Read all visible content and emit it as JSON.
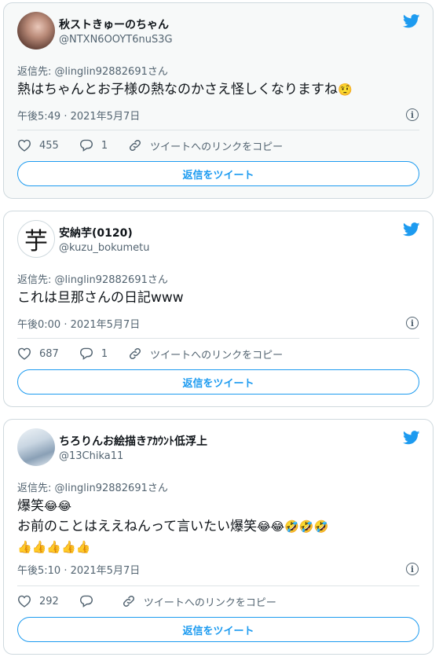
{
  "colors": {
    "accent": "#1d9bf0",
    "secondary_text": "#536471",
    "border": "#cfd9de"
  },
  "icons": [
    "twitter-bird-icon",
    "heart-icon",
    "reply-bubble-icon",
    "link-icon",
    "info-icon"
  ],
  "tweets": [
    {
      "name": "秋ストきゅーのちゃん",
      "handle": "@NTXN6OOYT6nuS3G",
      "reply_to": "返信先: @linglin92882691さん",
      "text_lines": [
        "熱はちゃんとお子様の熱なのかさえ怪しくなりますね"
      ],
      "emoji_line1": "🤨",
      "time": "午後5:49 · 2021年5月7日",
      "likes": "455",
      "replies": "1",
      "copy_link": "ツイートへのリンクをコピー",
      "reply_button": "返信をツイート"
    },
    {
      "name": "安納芋(0120)",
      "handle": "@kuzu_bokumetu",
      "avatar_char": "芋",
      "reply_to": "返信先: @linglin92882691さん",
      "text_lines": [
        "これは旦那さんの日記www"
      ],
      "time": "午後0:00 · 2021年5月7日",
      "likes": "687",
      "replies": "1",
      "copy_link": "ツイートへのリンクをコピー",
      "reply_button": "返信をツイート"
    },
    {
      "name": "ちろりんお絵描きｱｶｳﾝﾄ低浮上",
      "handle": "@13Chika11",
      "reply_to": "返信先: @linglin92882691さん",
      "text_lines": [
        "爆笑",
        "お前のことはええねんって言いたい爆笑"
      ],
      "emoji_line1": "😂😂",
      "emoji_line2": "😂😂🤣🤣🤣",
      "emoji_line3": "👍👍👍👍👍",
      "time": "午後5:10 · 2021年5月7日",
      "likes": "292",
      "copy_link": "ツイートへのリンクをコピー",
      "reply_button": "返信をツイート"
    }
  ]
}
